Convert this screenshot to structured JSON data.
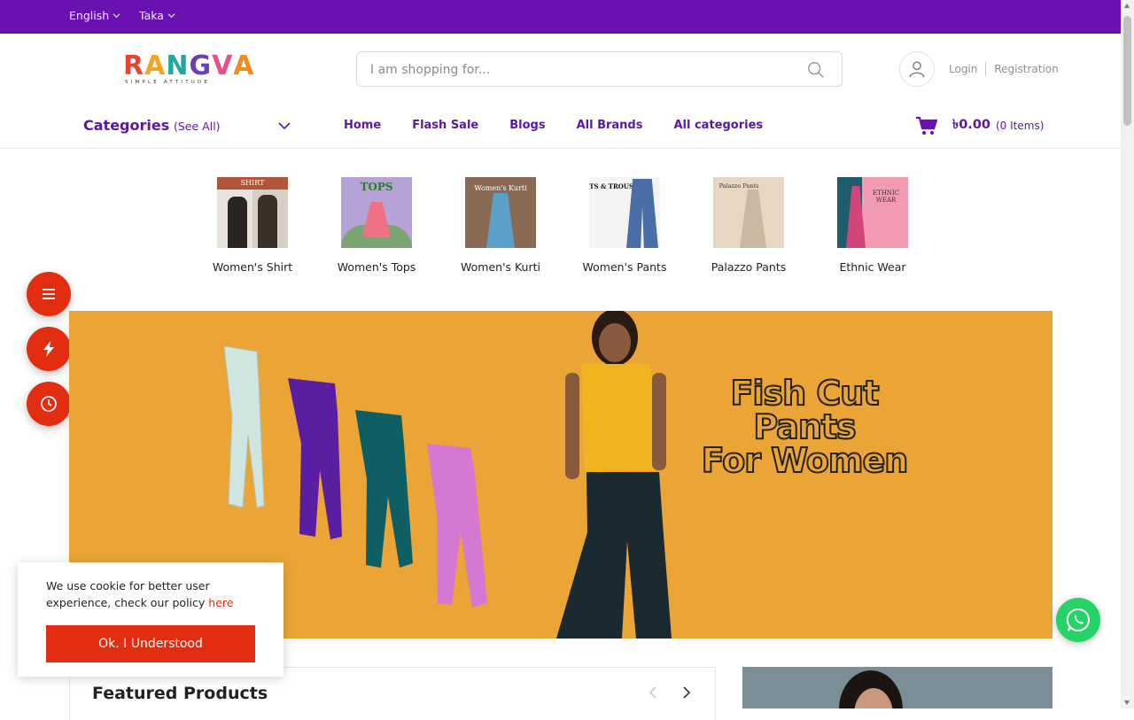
{
  "topbar": {
    "language": "English",
    "currency": "Taka",
    "bg_color": "#6a11b1"
  },
  "header": {
    "logo_text": "RANGVA",
    "logo_tagline": "SIMPLE ATTITUDE",
    "search_placeholder": "I am shopping for...",
    "login": "Login",
    "registration": "Registration"
  },
  "nav": {
    "categories_title": "Categories",
    "see_all": "(See All)",
    "links": [
      "Home",
      "Flash Sale",
      "Blogs",
      "All Brands",
      "All categories"
    ],
    "cart_amount": "৳0.00",
    "cart_items": "(0 Items)",
    "accent_color": "#5b179f"
  },
  "categories": [
    {
      "label": "Women's Shirt",
      "thumb_caption": "SHIRT"
    },
    {
      "label": "Women's Tops",
      "thumb_caption": "TOPS"
    },
    {
      "label": "Women's Kurti",
      "thumb_caption": "Women's Kurti"
    },
    {
      "label": "Women's Pants",
      "thumb_caption": "PANTS & TROUSERS"
    },
    {
      "label": "Palazzo Pants",
      "thumb_caption": "Palazzo Pants"
    },
    {
      "label": "Ethnic Wear",
      "thumb_caption": "ETHNIC WEAR"
    }
  ],
  "side_buttons": [
    "menu-icon",
    "flash-icon",
    "clock-icon"
  ],
  "banner": {
    "title_line1": "Fish Cut Pants",
    "title_line2": "For Women",
    "bg_color": "#eba436"
  },
  "cookie": {
    "text": "We use cookie for better user experience, check our policy ",
    "link": "here",
    "button": "Ok. I Understood",
    "button_color": "#e22d10"
  },
  "featured": {
    "title": "Featured Products"
  }
}
